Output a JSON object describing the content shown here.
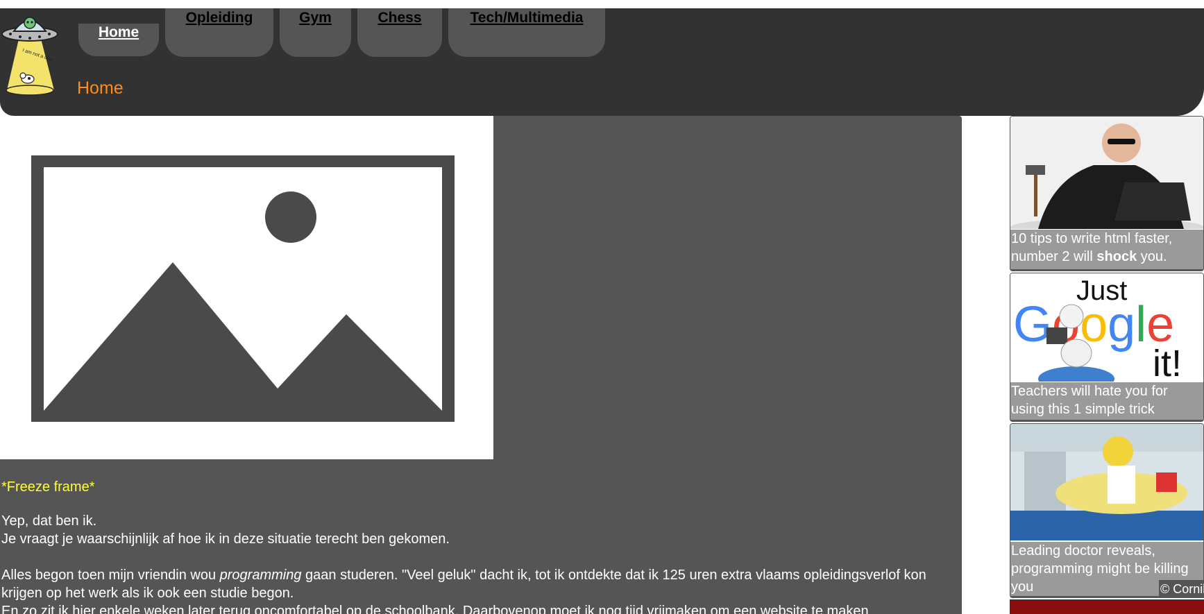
{
  "nav": {
    "tabs": [
      {
        "label": "Home"
      },
      {
        "label": "Opleiding"
      },
      {
        "label": "Gym"
      },
      {
        "label": "Chess"
      },
      {
        "label": "Tech/Multimedia"
      }
    ],
    "active": "Home"
  },
  "logo": {
    "text": "I am not a cow"
  },
  "page_title": "Home",
  "main": {
    "freeze_frame": "*Freeze frame*",
    "para1_line1": "Yep, dat ben ik.",
    "para1_line2": "Je vraagt je waarschijnlijk af hoe ik in deze situatie terecht ben gekomen.",
    "para2_before": "Alles begon toen mijn vriendin wou ",
    "para2_emphasis": "programming",
    "para2_after": " gaan studeren. \"Veel geluk\" dacht ik, tot ik ontdekte dat ik 125 uren extra vlaams opleidingsverlof kon krijgen op het werk als ik ook een studie begon.",
    "para3": "En zo zit ik hier enkele weken later terug oncomfortabel op de schoolbank. Daarbovenop moet ik nog tijd vrijmaken om een website te maken"
  },
  "sidebar": {
    "cards": [
      {
        "caption_before": "10 tips to write html faster, number 2 will ",
        "caption_bold": "shock",
        "caption_after": " you."
      },
      {
        "caption": "Teachers will hate you for using this 1 simple trick",
        "image_text_top": "Just",
        "image_text_bottom": "it!",
        "image_letters": [
          "G",
          "o",
          "o",
          "g",
          "l",
          "e"
        ]
      },
      {
        "caption": "Leading doctor reveals, programming might be killing you"
      }
    ],
    "copyright": "© Cornil"
  },
  "colors": {
    "header_bg": "#323232",
    "tab_bg": "#555555",
    "title_orange": "#ff8c1a",
    "freeze_yellow": "#ffff33",
    "main_bg": "#555555"
  }
}
